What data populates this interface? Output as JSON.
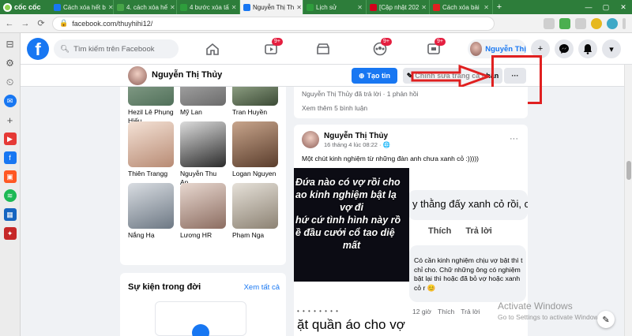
{
  "browser": {
    "brand": "cốc cốc",
    "tabs": [
      {
        "label": "Cách xóa hết b",
        "color": "#1877f2",
        "active": false
      },
      {
        "label": "4. cách xóa hế",
        "color": "#47a447",
        "active": false
      },
      {
        "label": "4 bước xóa tấ",
        "color": "#2e9d3c",
        "active": false
      },
      {
        "label": "Nguyễn Thị Th",
        "color": "#1877f2",
        "active": true
      },
      {
        "label": "Lịch sử",
        "color": "#2e9d3c",
        "active": false
      },
      {
        "label": "[Cập nhật 202",
        "color": "#d0021b",
        "active": false
      },
      {
        "label": "Cách xóa bài",
        "color": "#e02020",
        "active": false
      }
    ],
    "url": "facebook.com/thuyhihi12/"
  },
  "fb": {
    "logo": "f",
    "search_placeholder": "Tìm kiếm trên Facebook",
    "badges": {
      "watch": "9+",
      "groups": "9+",
      "gaming": "9+"
    },
    "profile_name": "Nguyễn Thị"
  },
  "profile": {
    "name": "Nguyễn Thị Thủy",
    "create_story": "Tạo tin",
    "edit_profile": "Chỉnh sửa trang cá nhân",
    "more": "···"
  },
  "friends": [
    {
      "name": "Hezil Lê Phụng Hiếu",
      "c1": "#9fb5a0",
      "c2": "#51705a"
    },
    {
      "name": "Mỹ Lan",
      "c1": "#c2c2c2",
      "c2": "#6b6b6b"
    },
    {
      "name": "Tran Huyền",
      "c1": "#c6d9b8",
      "c2": "#3b4a35"
    },
    {
      "name": "Thiên Trangg",
      "c1": "#f4e2d6",
      "c2": "#b88b74"
    },
    {
      "name": "Nguyễn Thu An",
      "c1": "#dcdcdc",
      "c2": "#2b2b2b"
    },
    {
      "name": "Logan Nguyen",
      "c1": "#c8a58c",
      "c2": "#5a3d2c"
    },
    {
      "name": "Nắng Hạ",
      "c1": "#d9dde2",
      "c2": "#6d7884"
    },
    {
      "name": "Lương HR",
      "c1": "#e8d8d0",
      "c2": "#8c6d61"
    },
    {
      "name": "Phạm Nga",
      "c1": "#e6e1d9",
      "c2": "#8c8273"
    }
  ],
  "events": {
    "title": "Sự kiện trong đời",
    "see_all": "Xem tất cả"
  },
  "post1": {
    "reply_line": "Nguyễn Thị Thủy đã trả lời · 1 phản hồi",
    "more_comments": "Xem thêm 5 bình luận"
  },
  "post2": {
    "author": "Nguyễn Thị Thủy",
    "time": "16 tháng 4 lúc 08:22 · 🌐",
    "caption": "Một chút kinh nghiệm từ những đàn anh chưa xanh cỏ :)))))",
    "meme_lines": [
      "Đứa nào có vợ rồi cho",
      "ao kinh nghiệm bật lạ",
      "vợ đi",
      "hứ cứ tình hình này rồ",
      "ề đầu cưới cổ tao diệ",
      "mất"
    ],
    "comment1": "y thằng đấy xanh cỏ rồi, c",
    "like": "Thích",
    "reply": "Trả lời",
    "comment2": "Có cần kinh nghiệm chịu vợ bật thì t chỉ cho. Chữ những ông có nghiệm bật lại thì hoặc đã bỏ vợ hoặc xanh cỏ r 😊",
    "foot_time": "12 giờ",
    "foot_like": "Thích",
    "foot_reply": "Trả lời",
    "dotsline": "• • • • • • • •",
    "bigtext": "ặt quần áo cho vợ"
  },
  "watermark": {
    "line1": "Activate Windows",
    "line2": "Go to Settings to activate Windows."
  }
}
